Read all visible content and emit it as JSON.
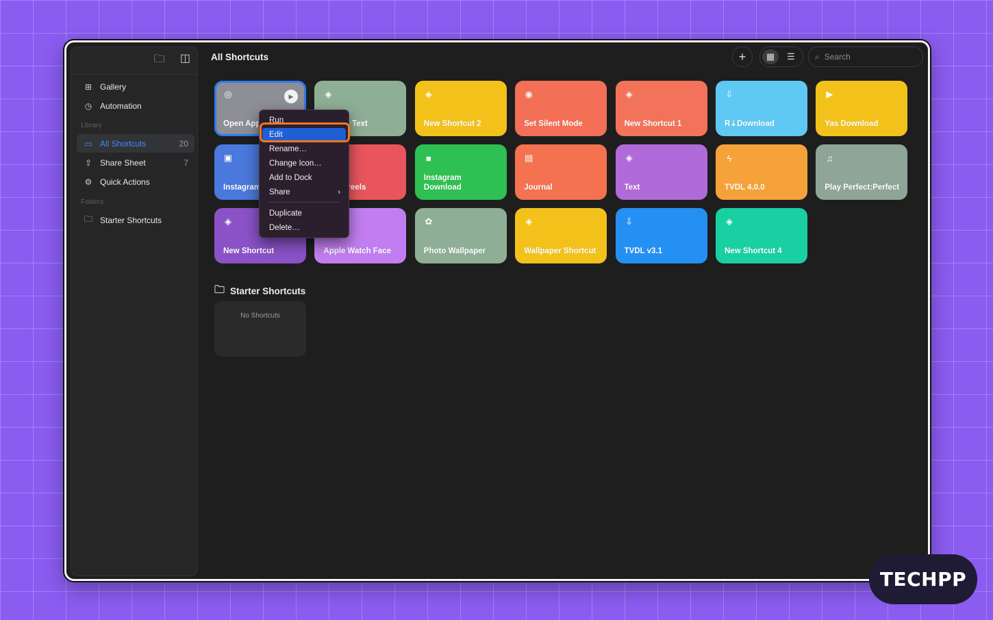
{
  "header": {
    "title": "All Shortcuts",
    "search_placeholder": "Search",
    "add_icon": "plus-icon",
    "grid_icon": "grid-icon",
    "list_icon": "list-icon"
  },
  "sidebar": {
    "top_icons": [
      "new-folder-icon",
      "sidebar-toggle-icon"
    ],
    "items": [
      {
        "label": "Gallery",
        "icon": "gallery-icon"
      },
      {
        "label": "Automation",
        "icon": "clock-icon"
      }
    ],
    "library_header": "Library",
    "library": [
      {
        "label": "All Shortcuts",
        "count": "20",
        "active": true
      },
      {
        "label": "Share Sheet",
        "count": "7"
      },
      {
        "label": "Quick Actions",
        "count": ""
      }
    ],
    "folders_header": "Folders",
    "folders": [
      {
        "label": "Starter Shortcuts"
      }
    ]
  },
  "shortcuts": [
    {
      "name": "Open App",
      "color": "#8e8f96",
      "icon": "safari-icon"
    },
    {
      "name": "…arise Text",
      "color": "#8fae96",
      "icon": "stack-icon"
    },
    {
      "name": "New Shortcut 2",
      "color": "#f2c21b",
      "icon": "stack-icon"
    },
    {
      "name": "Set Silent Mode",
      "color": "#f36f56",
      "icon": "watch-icon"
    },
    {
      "name": "New Shortcut 1",
      "color": "#f3735a",
      "icon": "stack-icon"
    },
    {
      "name": "R⇣Download",
      "color": "#5fc8f3",
      "icon": "download-icon"
    },
    {
      "name": "Yas Download",
      "color": "#f2c21b",
      "icon": "video-icon"
    },
    {
      "name": "Instagram",
      "color": "#4a78dc",
      "icon": "browser-icon"
    },
    {
      "name": "…oad reels",
      "color": "#e8555d",
      "icon": "stack-icon"
    },
    {
      "name": "Instagram Download",
      "color": "#2ec052",
      "icon": "square-icon"
    },
    {
      "name": "Journal",
      "color": "#f4724f",
      "icon": "notes-icon"
    },
    {
      "name": "Text",
      "color": "#b06ad9",
      "icon": "stack-icon"
    },
    {
      "name": "TVDL 4.0.0",
      "color": "#f6a23a",
      "icon": "bolt-icon"
    },
    {
      "name": "Play Perfect:Perfect",
      "color": "#8fa597",
      "icon": "music-icon"
    },
    {
      "name": "New Shortcut",
      "color": "#8b52c8",
      "icon": "stack-icon"
    },
    {
      "name": "Apple Watch Face",
      "color": "#c27ef0",
      "icon": "stack-icon"
    },
    {
      "name": "Photo Wallpaper",
      "color": "#8fae96",
      "icon": "photos-icon"
    },
    {
      "name": "Wallpaper Shortcut",
      "color": "#f2c21b",
      "icon": "stack-icon"
    },
    {
      "name": "TVDL v3.1",
      "color": "#2590f3",
      "icon": "download-icon"
    },
    {
      "name": "New Shortcut 4",
      "color": "#19d0a2",
      "icon": "stack-icon"
    }
  ],
  "folder_section": {
    "title": "Starter Shortcuts",
    "empty_text": "No Shortcuts"
  },
  "context_menu": {
    "items": [
      "Run",
      "Edit",
      "Rename…",
      "Change Icon…",
      "Add to Dock",
      "Share",
      "Duplicate",
      "Delete…"
    ],
    "highlighted": "Edit"
  },
  "watermark": "TECHPP"
}
